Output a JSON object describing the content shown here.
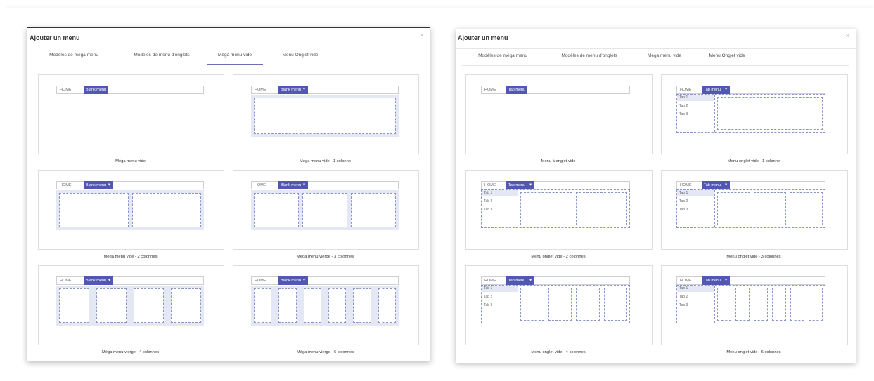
{
  "left_modal": {
    "title": "Ajouter un menu",
    "close_label": "×",
    "tabs": [
      {
        "label": "Modèles de méga menu"
      },
      {
        "label": "Modèles de menu d'onglets"
      },
      {
        "label": "Méga menu vide",
        "active": true
      },
      {
        "label": "Menu Onglet vide"
      }
    ],
    "home_label": "HOME",
    "menu_label": "Blank menu",
    "cards": [
      {
        "label": "Méga menu vide",
        "columns": 0
      },
      {
        "label": "Méga menu vide - 1 colonne",
        "columns": 1
      },
      {
        "label": "Méga menu vide - 2 colonnes",
        "columns": 2
      },
      {
        "label": "Méga menu vierge - 3 colonnes",
        "columns": 3
      },
      {
        "label": "Méga menu vierge - 4 colonnes",
        "columns": 4
      },
      {
        "label": "Méga menu vierge - 6 colonnes",
        "columns": 6
      }
    ]
  },
  "right_modal": {
    "title": "Ajouter un menu",
    "close_label": "×",
    "tabs": [
      {
        "label": "Modèles de méga menu"
      },
      {
        "label": "Modèles de menu d'onglets"
      },
      {
        "label": "Méga menu vide"
      },
      {
        "label": "Menu Onglet vide",
        "active": true
      }
    ],
    "home_label": "HOME",
    "menu_label": "Tab menu",
    "tab_items": [
      "Tab 1",
      "Tab 2",
      "Tab 3"
    ],
    "cards": [
      {
        "label": "Menu à onglet vide",
        "columns": 0
      },
      {
        "label": "Menu onglet vide - 1 colonne",
        "columns": 1
      },
      {
        "label": "Menu onglet vide - 2 colonnes",
        "columns": 2
      },
      {
        "label": "Menu onglet vide - 3 colonnes",
        "columns": 3
      },
      {
        "label": "Menu onglet vide - 4 colonnes",
        "columns": 4
      },
      {
        "label": "Menu onglet vide - 6 colonnes",
        "columns": 6
      }
    ]
  },
  "colors": {
    "accent": "#5157b3",
    "dropdown_bg": "#e4e8f4",
    "dashed_border": "#8b93c7"
  }
}
